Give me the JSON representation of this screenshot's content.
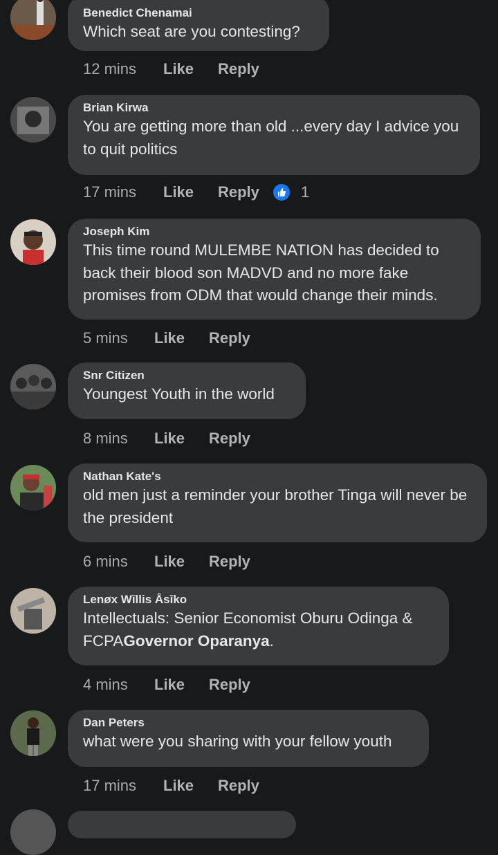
{
  "comments": [
    {
      "author": "Benedict Chenamai",
      "text": "Which seat are you contesting?",
      "time": "12 mins",
      "like": "Like",
      "reply": "Reply"
    },
    {
      "author": "Brian Kirwa",
      "text": "You are  getting more than old ...every day   I advice you to quit politics",
      "time": "17 mins",
      "like": "Like",
      "reply": "Reply",
      "reaction_count": "1"
    },
    {
      "author": "Joseph Kim",
      "text": "This time round MULEMBE NATION has decided to back their blood son MADVD and no more fake promises from ODM that would change their minds.",
      "time": "5 mins",
      "like": "Like",
      "reply": "Reply"
    },
    {
      "author": "Snr Citizen",
      "text": "Youngest Youth in the world",
      "time": "8 mins",
      "like": "Like",
      "reply": "Reply"
    },
    {
      "author": "Nathan Kate's",
      "text": "old men just a reminder your brother Tinga will never be the president",
      "time": "6 mins",
      "like": "Like",
      "reply": "Reply"
    },
    {
      "author": "Lenøx Wīllis Åsīko",
      "text": "Intellectuals: Senior Economist Oburu Odinga & FCPA",
      "text_bold": "Governor Oparanya",
      "text_end": ".",
      "time": "4 mins",
      "like": "Like",
      "reply": "Reply"
    },
    {
      "author": "Dan Peters",
      "text": "what were you sharing with your fellow youth",
      "time": "17 mins",
      "like": "Like",
      "reply": "Reply"
    }
  ],
  "colors": {
    "background": "#18191a",
    "bubble": "#3a3b3c",
    "text": "#e4e6eb",
    "meta": "#b0b3b8",
    "like_reaction": "#1877f2"
  },
  "icons": {
    "reaction": "like-reaction-icon"
  }
}
